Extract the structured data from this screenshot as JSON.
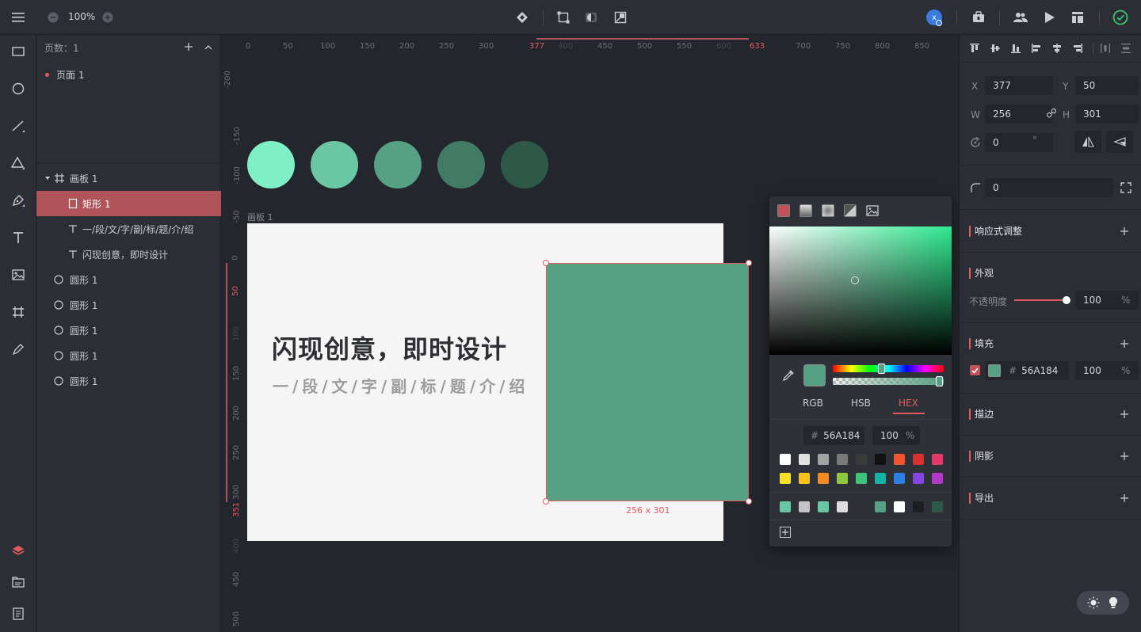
{
  "toolbar": {
    "zoom": "100%",
    "avatar_letter": "x"
  },
  "layers": {
    "page_count_label": "页数：1",
    "pages": [
      {
        "label": "页面 1"
      }
    ],
    "artboard": "画板 1",
    "items": [
      {
        "label": "矩形 1",
        "type": "rect",
        "selected": true
      },
      {
        "label": "一/段/文/字/副/标/题/介/绍",
        "type": "text"
      },
      {
        "label": "闪现创意，即时设计",
        "type": "text"
      },
      {
        "label": "圆形 1",
        "type": "circle"
      },
      {
        "label": "圆形 1",
        "type": "circle"
      },
      {
        "label": "圆形 1",
        "type": "circle"
      },
      {
        "label": "圆形 1",
        "type": "circle"
      },
      {
        "label": "圆形 1",
        "type": "circle"
      }
    ]
  },
  "rulers": {
    "h_ticks": [
      "0",
      "50",
      "100",
      "150",
      "200",
      "250",
      "300",
      "377",
      "400",
      "450",
      "500",
      "550",
      "600",
      "633",
      "700",
      "750",
      "800",
      "850"
    ],
    "h_highlight": [
      "377",
      "633"
    ],
    "v_ticks": [
      "-200",
      "-150",
      "-100",
      "-50",
      "0",
      "50",
      "100",
      "150",
      "200",
      "250",
      "300",
      "351",
      "400",
      "450",
      "500"
    ],
    "v_highlight": [
      "50",
      "351"
    ]
  },
  "canvas": {
    "artboard_label": "画板 1",
    "headline": "闪现创意，即时设计",
    "subtitle": "一/段/文/字/副/标/题/介/绍",
    "size_label": "256 x 301",
    "circle_colors": [
      "#7fefc5",
      "#6bc7a3",
      "#56a184",
      "#417b65",
      "#2e5847"
    ],
    "rect_color": "#56a184"
  },
  "color_picker": {
    "tabs": [
      "RGB",
      "HSB",
      "HEX"
    ],
    "active_tab": "HEX",
    "hex": "56A184",
    "hash": "#",
    "opacity": "100",
    "opacity_unit": "%",
    "preset_row1": [
      "#ffffff",
      "#e2e2e2",
      "#a3a3a3",
      "#7a7a7a",
      "#3a3a3a",
      "#111111",
      "#f1552e",
      "#d7302f",
      "#e2386a"
    ],
    "preset_row2": [
      "#f6e02c",
      "#f6c01d",
      "#f28b23",
      "#8fc73e",
      "#3fc27a",
      "#15b3a6",
      "#2e7fe4",
      "#8445e0",
      "#b238c7"
    ],
    "recent": [
      "#6bc7a3",
      "#c4c4c4",
      "#6bc7a3",
      "#dddddd",
      "#2e3036",
      "#56a184",
      "#ffffff",
      "#1d1e22",
      "#2e5847"
    ]
  },
  "properties": {
    "x_label": "X",
    "x": "377",
    "y_label": "Y",
    "y": "50",
    "w_label": "W",
    "w": "256",
    "h_label": "H",
    "h": "301",
    "rotation": "0",
    "degree": "°",
    "radius": "0",
    "responsive": "响应式调整",
    "appearance": "外观",
    "opacity_label": "不透明度",
    "opacity": "100",
    "opacity_unit": "%",
    "fill": "填充",
    "fill_hash": "#",
    "fill_hex": "56A184",
    "fill_opacity": "100",
    "fill_unit": "%",
    "stroke": "描边",
    "shadow": "阴影",
    "export": "导出"
  },
  "colors": {
    "accent": "#e55a61",
    "selection": "#b0545a",
    "ok": "#3ec46d"
  }
}
